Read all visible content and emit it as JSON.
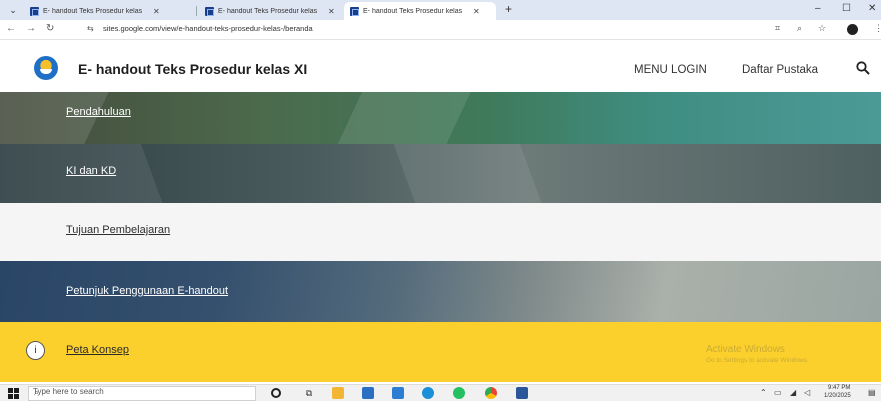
{
  "browser": {
    "tabs": [
      {
        "title": "E- handout Teks Prosedur kelas"
      },
      {
        "title": "E- handout Teks Prosedur kelas"
      },
      {
        "title": "E- handout Teks Prosedur kelas"
      }
    ],
    "url": "sites.google.com/view/e-handout-teks-prosedur-kelas-/beranda"
  },
  "site": {
    "title": "E- handout Teks Prosedur kelas XI",
    "nav": {
      "menu_login": "MENU LOGIN",
      "daftar_pustaka": "Daftar Pustaka"
    }
  },
  "sections": [
    {
      "label": "Pendahuluan"
    },
    {
      "label": "KI dan KD"
    },
    {
      "label": "Tujuan Pembelajaran"
    },
    {
      "label": "Petunjuk Penggunaan E-handout"
    },
    {
      "label": "Peta Konsep"
    }
  ],
  "watermark": {
    "title": "Activate Windows",
    "subtitle": "Go to Settings to activate Windows."
  },
  "taskbar": {
    "search_placeholder": "Type here to search",
    "time": "9:47 PM",
    "date": "1/20/2025"
  },
  "colors": {
    "section_yellow": "#fcd02c",
    "tab_strip": "#dfe6f3"
  }
}
